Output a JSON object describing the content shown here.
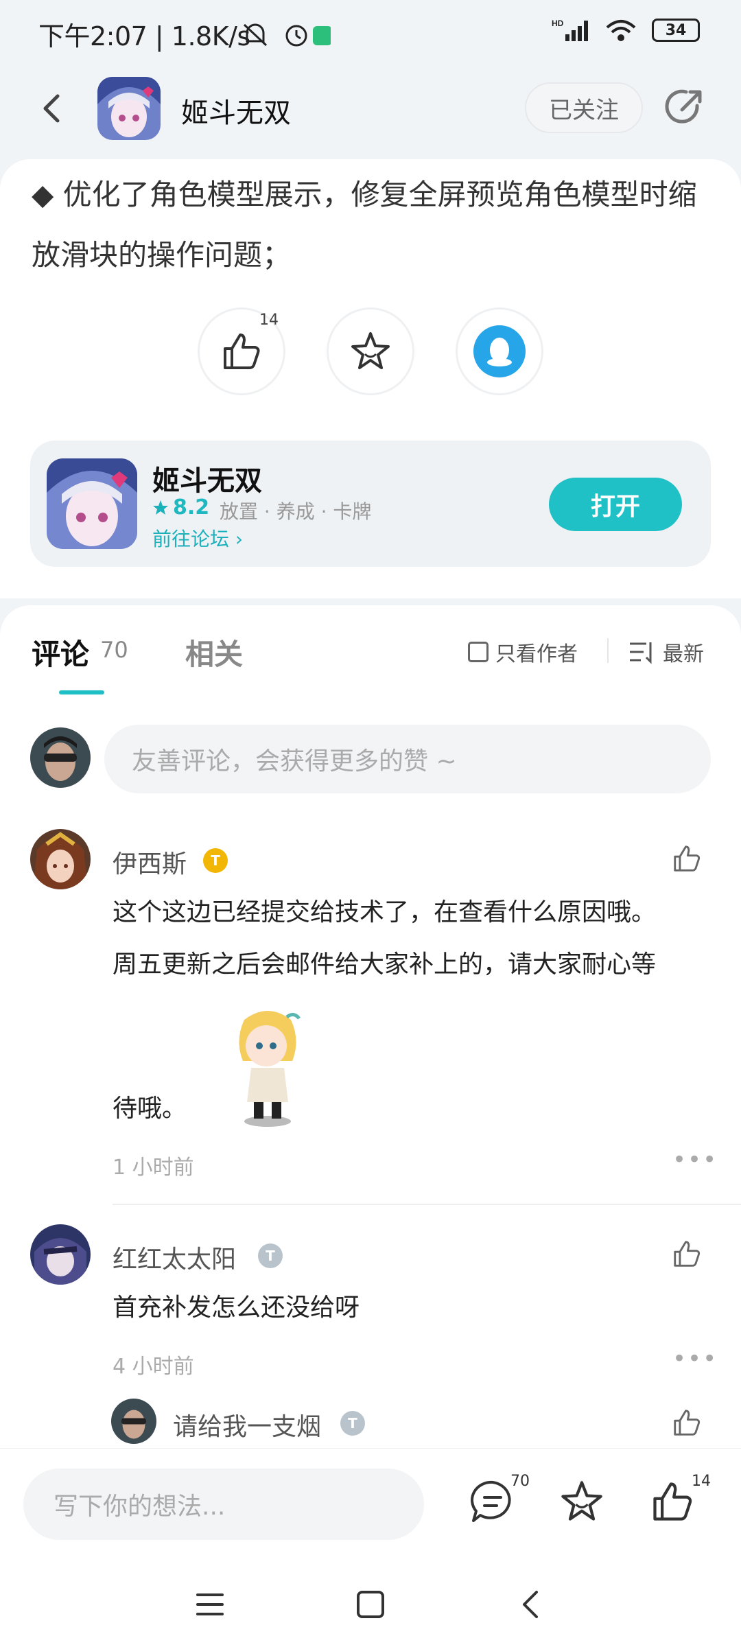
{
  "status_bar": {
    "text": "下午2:07 | 1.8K/s",
    "battery": "34"
  },
  "header": {
    "title": "姬斗无双",
    "follow_label": "已关注"
  },
  "article": {
    "text": "◆ 优化了角色模型展示，修复全屏预览角色模型时缩放滑块的操作问题；",
    "like_count": "14"
  },
  "game_card": {
    "name": "姬斗无双",
    "rating": "8.2",
    "tags": "放置 · 养成 · 卡牌",
    "forum_link": "前往论坛",
    "open_label": "打开"
  },
  "tabs": {
    "comments_label": "评论",
    "comments_count": "70",
    "related_label": "相关",
    "author_only_label": "只看作者",
    "sort_label": "最新"
  },
  "comment_input": {
    "placeholder": "友善评论，会获得更多的赞 ~"
  },
  "comments": [
    {
      "name": "伊西斯",
      "badge": "T",
      "text_lines": [
        "这个这边已经提交给技术了，在查看什么原因哦。",
        "周五更新之后会邮件给大家补上的，请大家耐心等",
        "待哦。"
      ],
      "time": "1 小时前"
    },
    {
      "name": "红红太太阳",
      "badge": "T",
      "text_lines": [
        "首充补发怎么还没给呀"
      ],
      "time": "4 小时前"
    },
    {
      "name": "请给我一支烟",
      "badge": "T"
    }
  ],
  "bottom_bar": {
    "placeholder": "写下你的想法...",
    "comment_count": "70",
    "like_count": "14"
  },
  "colors": {
    "accent": "#1fc0c6",
    "gold_badge": "#f2b705",
    "silver_badge": "#b9c3cc"
  }
}
